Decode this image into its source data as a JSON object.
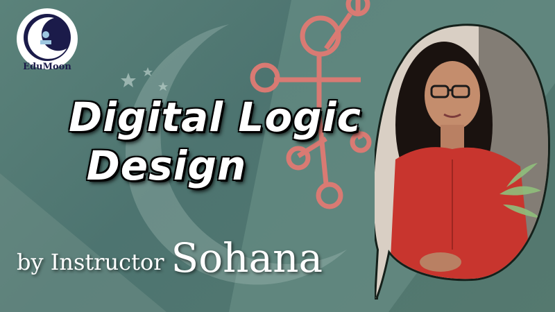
{
  "brand": {
    "logo_text": "EduMoon",
    "colors": {
      "circuit": "#e07a73",
      "accent_dark": "#1b1b4a",
      "bg": "#4f766e"
    }
  },
  "title": {
    "line1": "Digital Logic",
    "line2": "Design"
  },
  "byline": {
    "prefix": "by Instructor",
    "name": "Sohana"
  },
  "portrait": {
    "dress_color": "#c8352e"
  }
}
